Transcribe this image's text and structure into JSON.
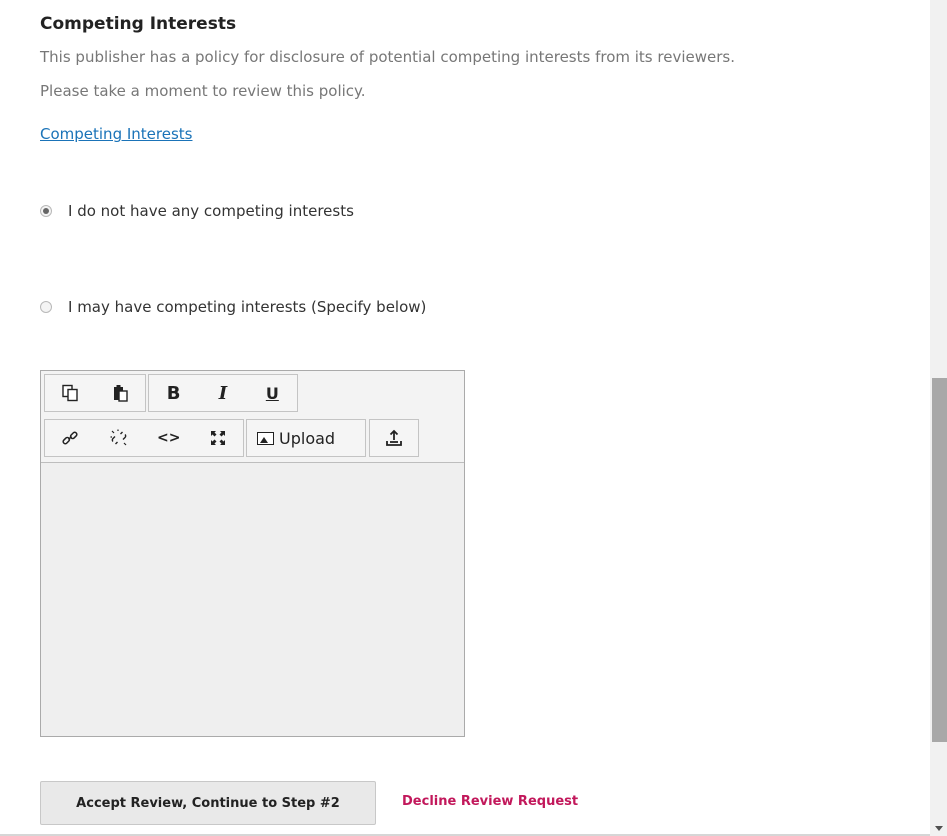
{
  "section": {
    "title": "Competing Interests",
    "description_line1": "This publisher has a policy for disclosure of potential competing interests from its reviewers.",
    "description_line2": "Please take a moment to review this policy.",
    "policy_link": "Competing Interests"
  },
  "options": [
    {
      "label": "I do not have any competing interests",
      "checked": true
    },
    {
      "label": "I may have competing interests (Specify below)",
      "checked": false
    }
  ],
  "editor": {
    "toolbar": {
      "row1": [
        "copy-icon",
        "paste-icon",
        "B",
        "I",
        "U"
      ],
      "row2": [
        "link-icon",
        "unlink-icon",
        "<>",
        "fullscreen-icon",
        "Upload",
        "insert-icon"
      ],
      "bold_label": "B",
      "italic_label": "I",
      "underline_label": "U",
      "code_label": "<>",
      "upload_label": "Upload"
    },
    "value": ""
  },
  "actions": {
    "accept_label": "Accept Review, Continue to Step #2",
    "decline_label": "Decline Review Request"
  },
  "colors": {
    "link": "#1a73b8",
    "decline": "#c2185b",
    "text_muted": "#777777"
  }
}
